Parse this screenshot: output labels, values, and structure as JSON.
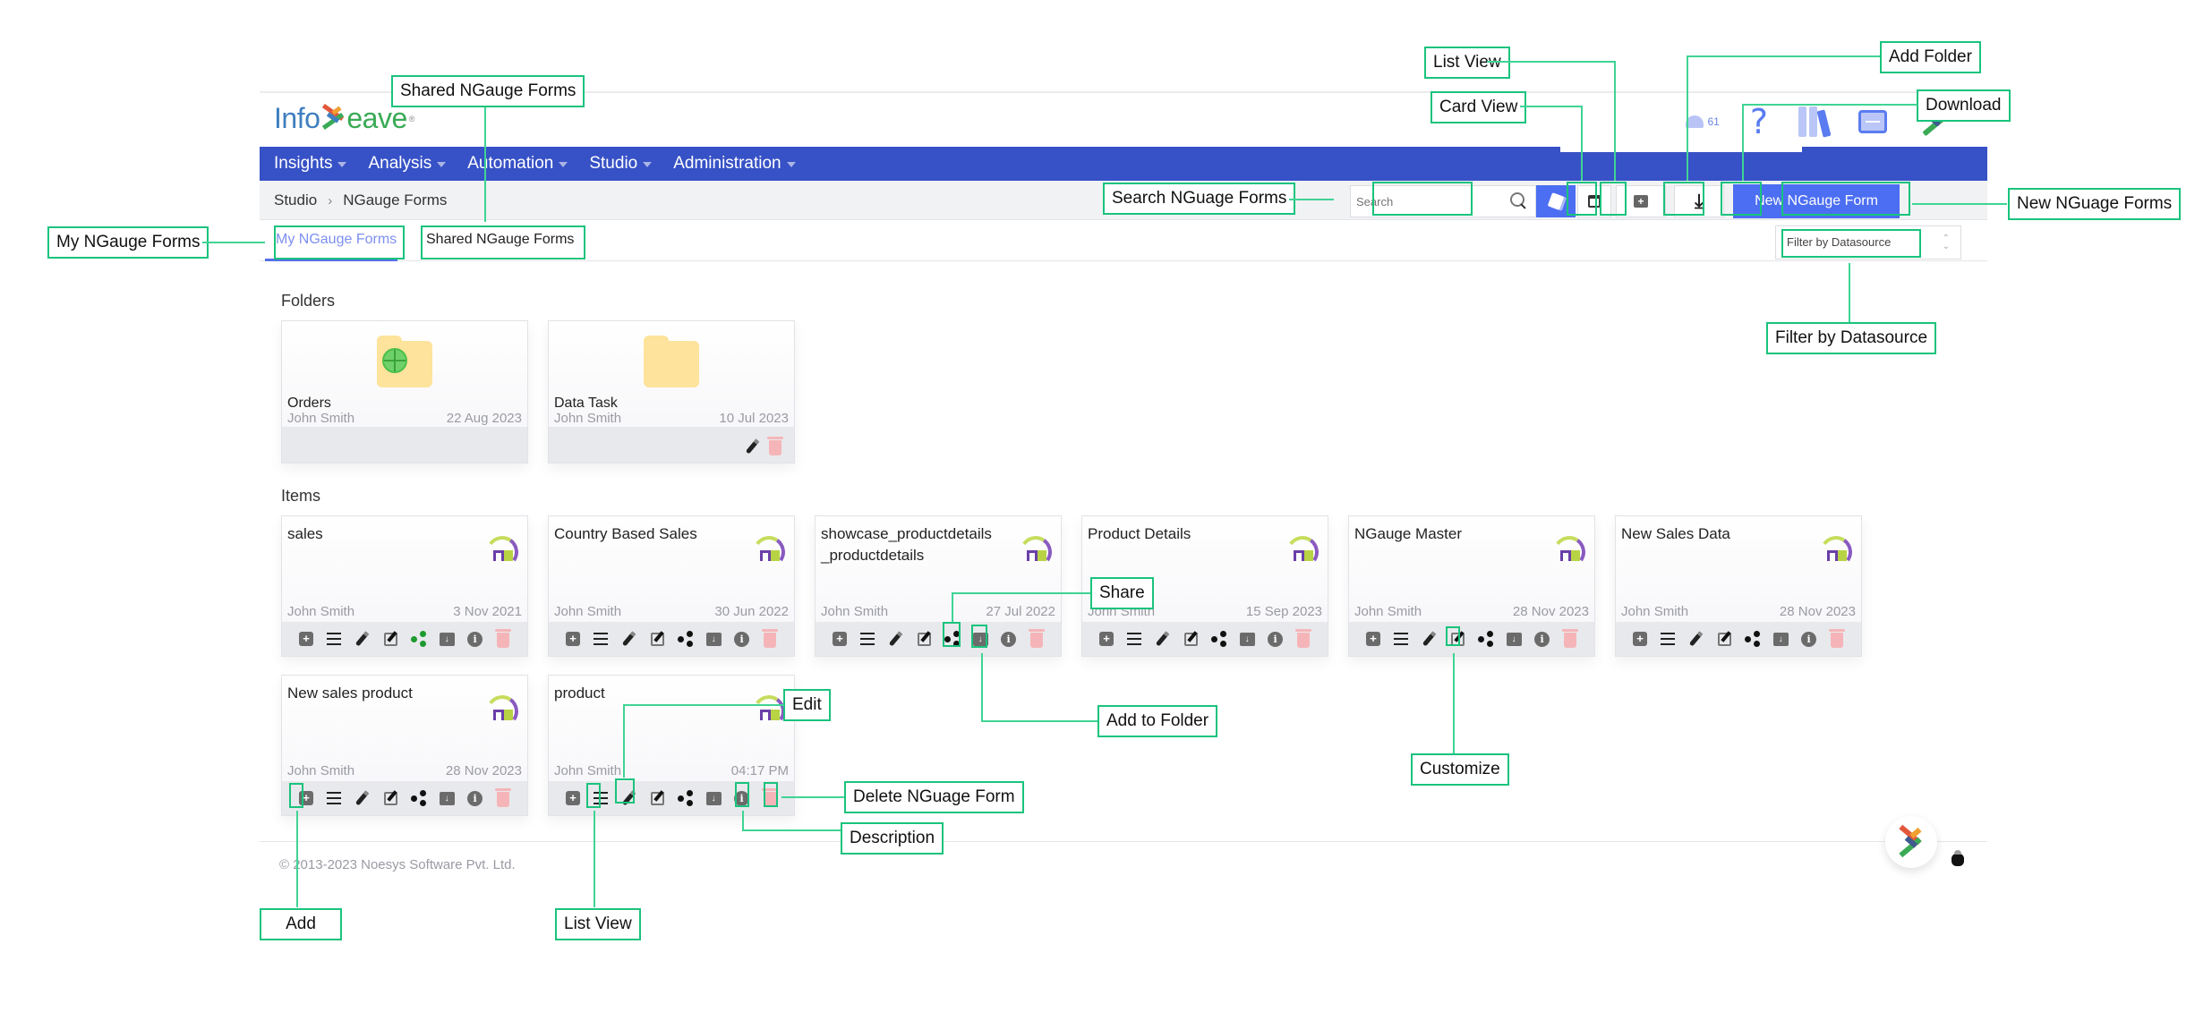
{
  "header": {
    "logo": {
      "text_left": "Info",
      "text_right": "eave",
      "brand_colors": {
        "blue": "#3f7fbf",
        "green": "#3aaa55"
      }
    },
    "notification_count": "61",
    "icons": [
      "bell-icon",
      "help-icon",
      "library-icon",
      "monitor-icon",
      "infoveave-logo-icon"
    ]
  },
  "nav": {
    "items": [
      {
        "label": "Insights"
      },
      {
        "label": "Analysis"
      },
      {
        "label": "Automation"
      },
      {
        "label": "Studio"
      },
      {
        "label": "Administration"
      }
    ],
    "bg_color": "#3751c6"
  },
  "breadcrumb": {
    "items": [
      "Studio",
      "NGauge Forms"
    ],
    "separator": "›"
  },
  "toolbar": {
    "search_placeholder": "Search",
    "new_form_label": "New NGauge Form",
    "accent": "#4c6ef2"
  },
  "tabs": {
    "my": "My NGauge Forms",
    "shared": "Shared NGauge Forms",
    "active": "my"
  },
  "filter": {
    "placeholder": "Filter by Datasource"
  },
  "folders": {
    "title": "Folders",
    "items": [
      {
        "name": "Orders",
        "owner": "John Smith",
        "date": "22 Aug 2023",
        "has_globe": true
      },
      {
        "name": "Data Task",
        "owner": "John Smith",
        "date": "10 Jul 2023",
        "has_globe": false
      }
    ]
  },
  "items": {
    "title": "Items",
    "list": [
      {
        "name": "sales",
        "owner": "John Smith",
        "date": "3 Nov 2021",
        "shared": true
      },
      {
        "name": "Country Based Sales",
        "owner": "John Smith",
        "date": "30 Jun 2022",
        "shared": false
      },
      {
        "name": "showcase_productdetails_productdetails",
        "owner": "John Smith",
        "date": "27 Jul 2022",
        "shared": false
      },
      {
        "name": "Product Details",
        "owner": "John Smith",
        "date": "15 Sep 2023",
        "shared": false
      },
      {
        "name": "NGauge Master",
        "owner": "John Smith",
        "date": "28 Nov 2023",
        "shared": false
      },
      {
        "name": "New Sales Data",
        "owner": "John Smith",
        "date": "28 Nov 2023",
        "shared": false
      },
      {
        "name": "New sales product",
        "owner": "John Smith",
        "date": "28 Nov 2023",
        "shared": false
      },
      {
        "name": "product",
        "owner": "John Smith",
        "date": "04:17 PM",
        "shared": false
      }
    ],
    "actions": [
      "add",
      "list-view",
      "edit",
      "customize",
      "share",
      "add-to-folder",
      "description",
      "delete"
    ]
  },
  "footer": {
    "copyright": "© 2013-2023 Noesys Software Pvt. Ltd."
  },
  "annotations": {
    "shared_forms": "Shared NGauge Forms",
    "my_forms": "My NGauge Forms",
    "search": "Search NGuage Forms",
    "card_view": "Card View",
    "list_view_top": "List View",
    "add_folder": "Add Folder",
    "download": "Download",
    "new_forms": "New NGuage Forms",
    "filter": "Filter by Datasource",
    "share": "Share",
    "edit": "Edit",
    "add_to_folder": "Add to Folder",
    "customize": "Customize",
    "delete": "Delete NGuage Form",
    "description": "Description",
    "add": "Add",
    "list_view_bottom": "List View",
    "color": "#19c37d"
  }
}
